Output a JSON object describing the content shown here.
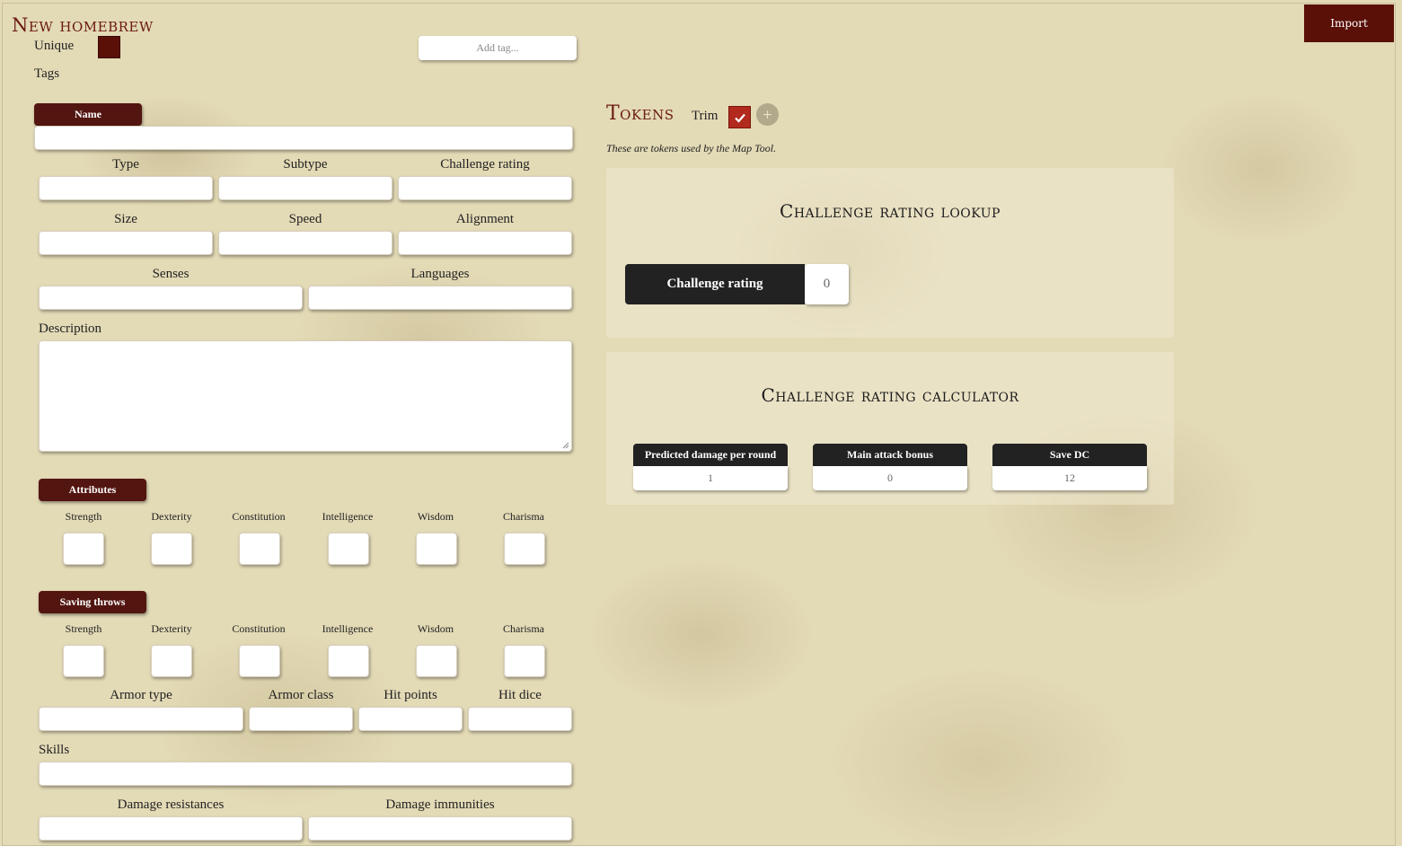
{
  "header": {
    "title": "New homebrew",
    "import_label": "Import",
    "unique_label": "Unique",
    "tags_label": "Tags",
    "add_tag_placeholder": "Add tag..."
  },
  "form": {
    "name_label": "Name",
    "type_label": "Type",
    "subtype_label": "Subtype",
    "challenge_rating_label": "Challenge rating",
    "size_label": "Size",
    "speed_label": "Speed",
    "alignment_label": "Alignment",
    "senses_label": "Senses",
    "languages_label": "Languages",
    "description_label": "Description",
    "attributes_label": "Attributes",
    "saving_throws_label": "Saving throws",
    "abilities": [
      "Strength",
      "Dexterity",
      "Constitution",
      "Intelligence",
      "Wisdom",
      "Charisma"
    ],
    "armor_type_label": "Armor type",
    "armor_class_label": "Armor class",
    "hit_points_label": "Hit points",
    "hit_dice_label": "Hit dice",
    "skills_label": "Skills",
    "damage_resistances_label": "Damage resistances",
    "damage_immunities_label": "Damage immunities"
  },
  "tokens": {
    "title": "Tokens",
    "trim_label": "Trim",
    "trim_checked": true,
    "plus_icon": "+",
    "note": "These are tokens used by the Map Tool."
  },
  "cr_lookup": {
    "title": "Challenge rating lookup",
    "button_label": "Challenge rating",
    "value": "0"
  },
  "cr_calculator": {
    "title": "Challenge rating calculator",
    "fields": [
      {
        "label": "Predicted damage per round",
        "value": "1"
      },
      {
        "label": "Main attack bonus",
        "value": "0"
      },
      {
        "label": "Save DC",
        "value": "12"
      }
    ]
  },
  "colors": {
    "accent": "#5a0f07",
    "title_red": "#6b1a12",
    "dark": "#222222",
    "check_red": "#b22a1e"
  }
}
